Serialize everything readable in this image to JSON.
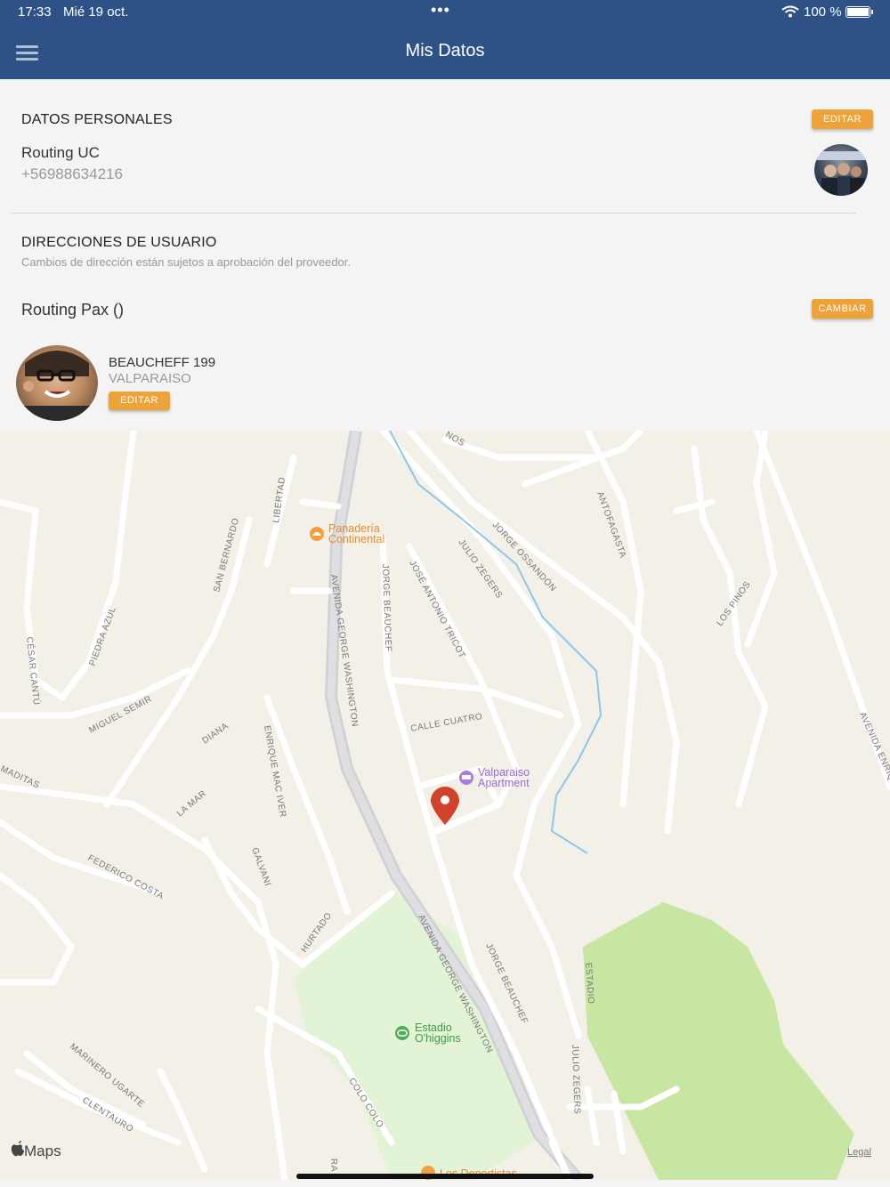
{
  "status_bar": {
    "time": "17:33",
    "date": "Mié 19 oct.",
    "dots": "•••",
    "battery": "100 %"
  },
  "nav": {
    "title": "Mis Datos",
    "menu_icon": "hamburger-menu-icon"
  },
  "personal": {
    "heading": "DATOS PERSONALES",
    "edit_label": "EDITAR",
    "name": "Routing UC",
    "phone": "+56988634216"
  },
  "addresses": {
    "heading": "DIRECCIONES DE USUARIO",
    "subtitle": "Cambios de dirección están sujetos a aprobación del proveedor.",
    "passenger": "Routing Pax ()",
    "change_label": "CAMBIAR",
    "street": "BEAUCHEFF 199",
    "city": "VALPARAISO",
    "edit_label": "EDITAR"
  },
  "map": {
    "streets": [
      "AVENIDA GEORGE WASHINGTON",
      "AVENIDA GEORGE WASHINGTON",
      "JORGE BEAUCHEF",
      "JORGE BEAUCHEF",
      "JOSÉ ANTONIO TRICOT",
      "JULIO ZEGERS",
      "JULIO ZEGERS",
      "JORGE OSSANDÓN",
      "ANTOFAGASTA",
      "LOS PINOS",
      "AVENIDA ENRIQU",
      "CALLE CUATRO",
      "ENRIQUE MAC IVER",
      "GALVANI",
      "HURTADO",
      "ESTADIO",
      "COLO COLO",
      "LIBERTAD",
      "SAN BERNARDO",
      "PIEDRA AZUL",
      "CÉSAR CANTÚ",
      "MIGUEL SEMIR",
      "DIANA",
      "LA MAR",
      "MADITAS",
      "FEDERICO COSTA",
      "MARINERO UGARTE",
      "CLENTAURO",
      "NOS",
      "RA"
    ],
    "pois": {
      "bakery_line1": "Panadería",
      "bakery_line2": "Continental",
      "apartment_line1": "Valparaiso",
      "apartment_line2": "Apartment",
      "stadium_line1": "Estadio",
      "stadium_line2": "O'higgins",
      "bottom_poi": "Los Deportistas"
    },
    "apple_maps": "Maps",
    "legal": "Legal"
  }
}
